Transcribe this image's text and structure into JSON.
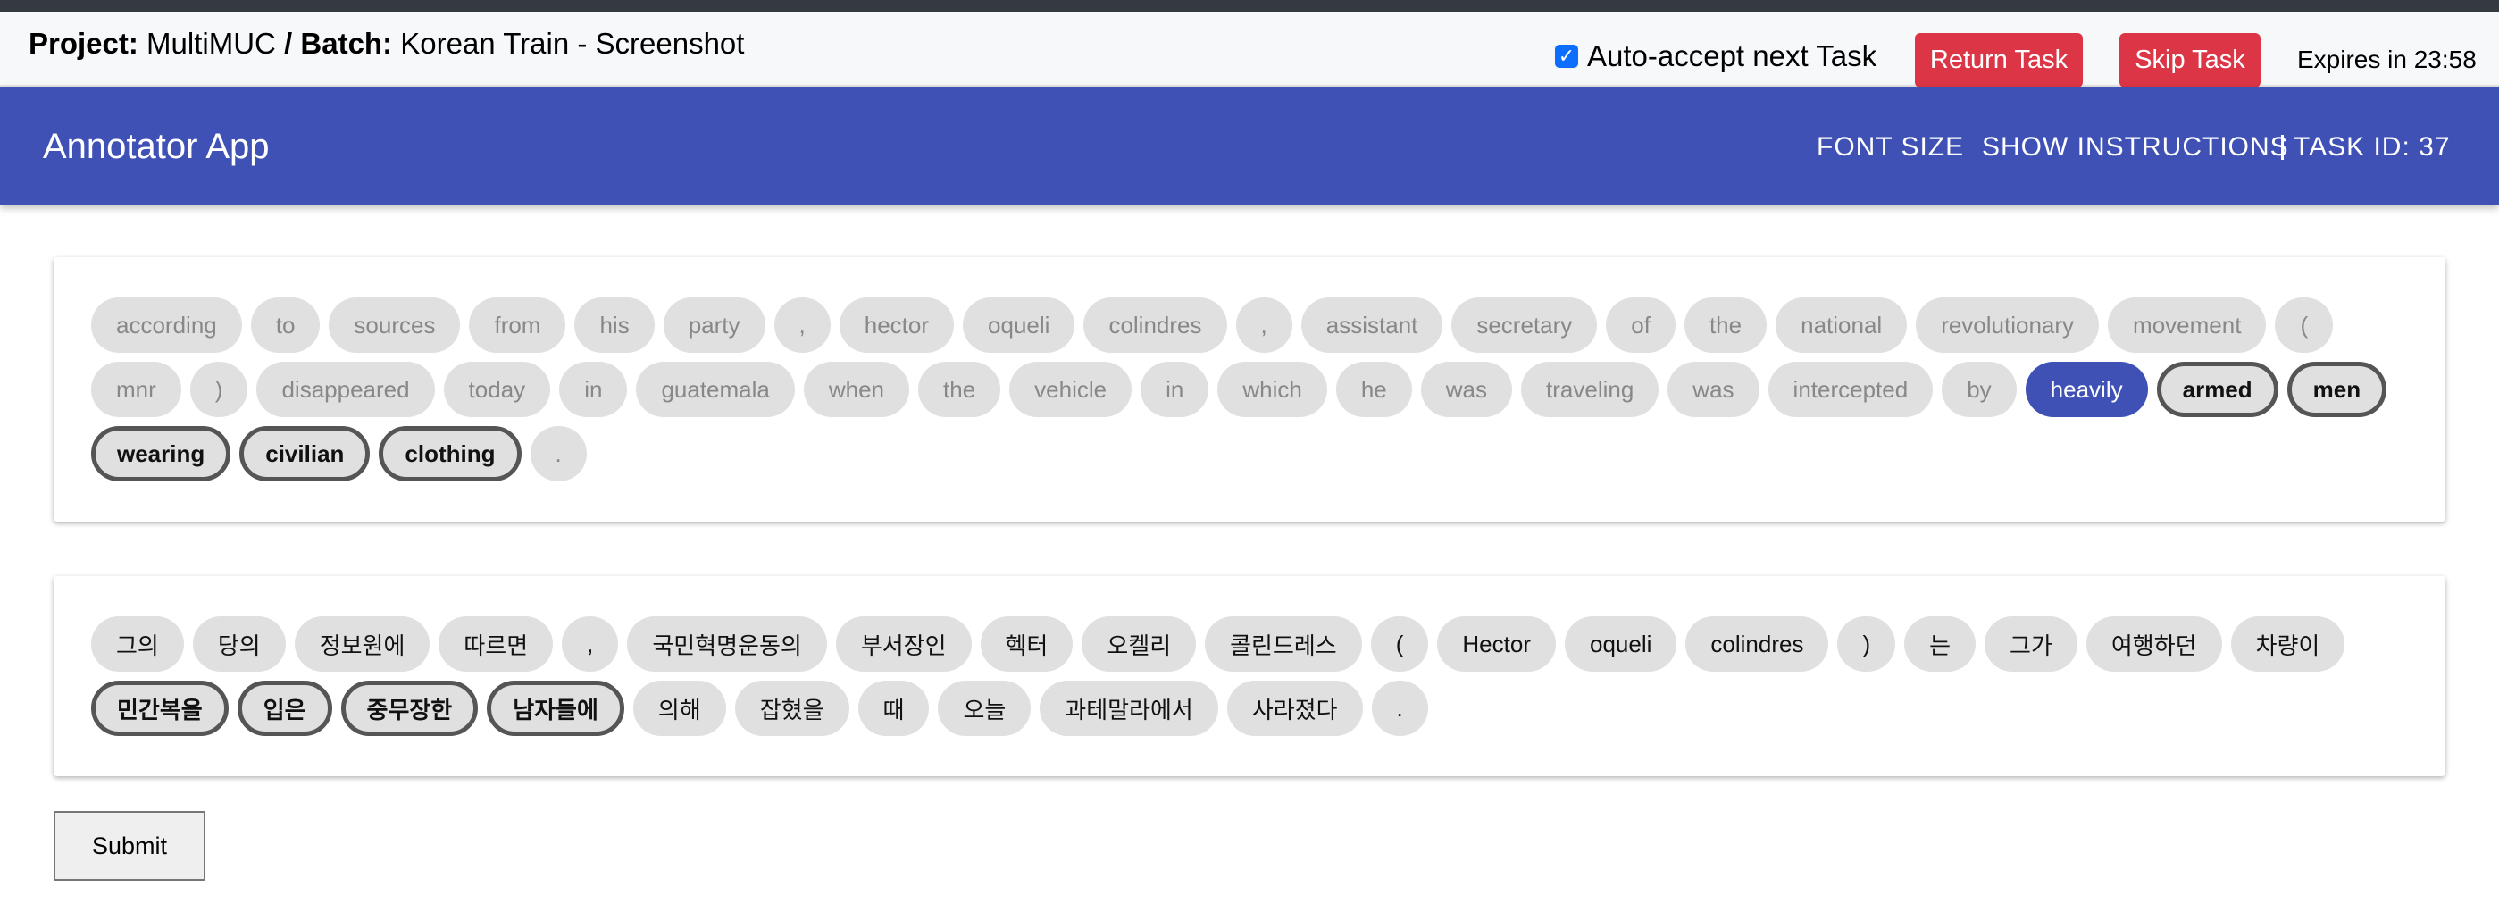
{
  "project": {
    "project_label": "Project:",
    "project_name": "MultiMUC",
    "slash": "/",
    "batch_label": "Batch:",
    "batch_name": "Korean Train - Screenshot"
  },
  "controls": {
    "auto_accept_label": "Auto-accept next Task",
    "auto_accept_checked": true,
    "return_label": "Return Task",
    "skip_label": "Skip Task",
    "expires": "Expires in 23:58",
    "button_color": "#dc3545"
  },
  "appbar": {
    "title": "Annotator App",
    "font_size": "FONT SIZE",
    "show_instructions": "SHOW INSTRUCTIONS",
    "task_id": "TASK ID: 37",
    "color": "#3f51b5"
  },
  "source_tokens": [
    {
      "text": "according",
      "state": "none"
    },
    {
      "text": "to",
      "state": "none"
    },
    {
      "text": "sources",
      "state": "none"
    },
    {
      "text": "from",
      "state": "none"
    },
    {
      "text": "his",
      "state": "none"
    },
    {
      "text": "party",
      "state": "none"
    },
    {
      "text": ",",
      "state": "none"
    },
    {
      "text": "hector",
      "state": "none"
    },
    {
      "text": "oqueli",
      "state": "none"
    },
    {
      "text": "colindres",
      "state": "none"
    },
    {
      "text": ",",
      "state": "none"
    },
    {
      "text": "assistant",
      "state": "none"
    },
    {
      "text": "secretary",
      "state": "none"
    },
    {
      "text": "of",
      "state": "none"
    },
    {
      "text": "the",
      "state": "none"
    },
    {
      "text": "national",
      "state": "none"
    },
    {
      "text": "revolutionary",
      "state": "none"
    },
    {
      "text": "movement",
      "state": "none"
    },
    {
      "text": "(",
      "state": "none"
    },
    {
      "text": "mnr",
      "state": "none"
    },
    {
      "text": ")",
      "state": "none"
    },
    {
      "text": "disappeared",
      "state": "none"
    },
    {
      "text": "today",
      "state": "none"
    },
    {
      "text": "in",
      "state": "none"
    },
    {
      "text": "guatemala",
      "state": "none"
    },
    {
      "text": "when",
      "state": "none"
    },
    {
      "text": "the",
      "state": "none"
    },
    {
      "text": "vehicle",
      "state": "none"
    },
    {
      "text": "in",
      "state": "none"
    },
    {
      "text": "which",
      "state": "none"
    },
    {
      "text": "he",
      "state": "none"
    },
    {
      "text": "was",
      "state": "none"
    },
    {
      "text": "traveling",
      "state": "none"
    },
    {
      "text": "was",
      "state": "none"
    },
    {
      "text": "intercepted",
      "state": "none"
    },
    {
      "text": "by",
      "state": "none"
    },
    {
      "text": "heavily",
      "state": "selected"
    },
    {
      "text": "armed",
      "state": "highlighted"
    },
    {
      "text": "men",
      "state": "highlighted"
    },
    {
      "text": "wearing",
      "state": "highlighted"
    },
    {
      "text": "civilian",
      "state": "highlighted"
    },
    {
      "text": "clothing",
      "state": "highlighted"
    },
    {
      "text": ".",
      "state": "none"
    }
  ],
  "target_tokens": [
    {
      "text": "그의",
      "state": "none"
    },
    {
      "text": "당의",
      "state": "none"
    },
    {
      "text": "정보원에",
      "state": "none"
    },
    {
      "text": "따르면",
      "state": "none"
    },
    {
      "text": ",",
      "state": "none"
    },
    {
      "text": "국민혁명운동의",
      "state": "none"
    },
    {
      "text": "부서장인",
      "state": "none"
    },
    {
      "text": "헥터",
      "state": "none"
    },
    {
      "text": "오켈리",
      "state": "none"
    },
    {
      "text": "콜린드레스",
      "state": "none"
    },
    {
      "text": "(",
      "state": "none"
    },
    {
      "text": "Hector",
      "state": "none"
    },
    {
      "text": "oqueli",
      "state": "none"
    },
    {
      "text": "colindres",
      "state": "none"
    },
    {
      "text": ")",
      "state": "none"
    },
    {
      "text": "는",
      "state": "none"
    },
    {
      "text": "그가",
      "state": "none"
    },
    {
      "text": "여행하던",
      "state": "none"
    },
    {
      "text": "차량이",
      "state": "none"
    },
    {
      "text": "민간복을",
      "state": "highlighted"
    },
    {
      "text": "입은",
      "state": "highlighted"
    },
    {
      "text": "중무장한",
      "state": "highlighted"
    },
    {
      "text": "남자들에",
      "state": "highlighted"
    },
    {
      "text": "의해",
      "state": "none"
    },
    {
      "text": "잡혔을",
      "state": "none"
    },
    {
      "text": "때",
      "state": "none"
    },
    {
      "text": "오늘",
      "state": "none"
    },
    {
      "text": "과테말라에서",
      "state": "none"
    },
    {
      "text": "사라졌다",
      "state": "none"
    },
    {
      "text": ".",
      "state": "none"
    }
  ],
  "submit_label": "Submit"
}
